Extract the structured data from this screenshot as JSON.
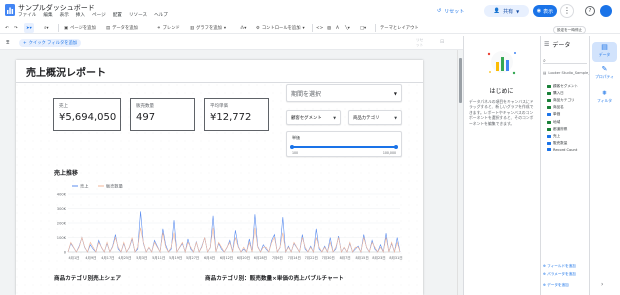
{
  "app": {
    "title": "サンプルダッシュボード",
    "menu": [
      "ファイル",
      "編集",
      "表示",
      "挿入",
      "ページ",
      "配置",
      "リソース",
      "ヘルプ"
    ],
    "reset_label": "リセット",
    "share_label": "共有",
    "view_label": "表示"
  },
  "toolbar": {
    "add_page": "ページを追加",
    "add_data": "データを追加",
    "blend": "ブレンド",
    "add_chart": "グラフを追加",
    "add_control": "コントロールを追加",
    "theme_layout": "テーマとレイアウト",
    "settings": "設定を一時停止"
  },
  "filterbar": {
    "quick_filter": "クイック フィルタを追加",
    "redo_line1": "リセ",
    "redo_line2": "ット"
  },
  "report": {
    "title": "売上概況レポート",
    "scorecards": [
      {
        "label": "売上",
        "value": "¥5,694,050"
      },
      {
        "label": "販売数量",
        "value": "497"
      },
      {
        "label": "平均単価",
        "value": "¥12,772"
      }
    ],
    "date_control": "期間を選択",
    "dropdowns": [
      "顧客セグメント",
      "商品カテゴリ"
    ],
    "slider": {
      "label": "単価",
      "min_label": "100",
      "max_label": "100,000",
      "low": 0.0,
      "high": 1.0
    },
    "line_chart_title": "売上推移",
    "bottom_titles": [
      "商品カテゴリ別売上シェア",
      "商品カテゴリ別：販売数量×単価の売上バブルチャート"
    ]
  },
  "chart_data": {
    "type": "line",
    "legend_position": "top-left",
    "series": [
      {
        "name": "売上",
        "color": "#5b8def",
        "values": [
          0,
          60,
          30,
          0,
          40,
          100,
          30,
          0,
          50,
          20,
          0,
          80,
          30,
          0,
          60,
          0,
          40,
          120,
          20,
          0,
          60,
          0,
          30,
          90,
          0,
          20,
          280,
          60,
          0,
          30,
          0,
          80,
          40,
          0,
          160,
          50,
          0,
          20,
          220,
          0,
          30,
          60,
          0,
          90,
          20,
          0,
          70,
          0,
          40,
          100,
          0,
          30,
          250,
          0,
          60,
          20,
          0,
          30,
          80,
          0,
          150,
          40,
          0,
          20,
          0,
          90,
          0,
          260,
          40,
          0,
          50,
          20,
          0,
          80,
          120,
          0,
          30,
          240,
          0,
          40,
          0,
          60,
          30,
          0,
          120,
          20,
          0,
          40,
          0,
          160,
          20,
          0,
          40,
          0,
          100,
          0,
          20,
          110,
          0,
          30,
          0,
          60,
          0,
          20,
          40,
          0,
          120,
          30,
          0,
          80,
          20,
          0,
          50,
          0,
          130,
          0,
          60,
          0,
          100,
          0
        ]
      },
      {
        "name": "販売数量",
        "color": "#f3b79a",
        "values": [
          0,
          2,
          1,
          0,
          1,
          3,
          1,
          0,
          2,
          1,
          0,
          2,
          1,
          0,
          2,
          0,
          1,
          3,
          1,
          0,
          2,
          0,
          1,
          3,
          0,
          1,
          5,
          2,
          0,
          1,
          0,
          2,
          1,
          0,
          4,
          1,
          0,
          1,
          4,
          0,
          1,
          2,
          0,
          2,
          1,
          0,
          2,
          0,
          1,
          3,
          0,
          1,
          5,
          0,
          2,
          1,
          0,
          1,
          2,
          0,
          3,
          1,
          0,
          1,
          0,
          2,
          0,
          5,
          1,
          0,
          1,
          1,
          0,
          2,
          3,
          0,
          1,
          4,
          0,
          1,
          0,
          2,
          1,
          0,
          3,
          1,
          0,
          1,
          0,
          3,
          1,
          0,
          1,
          0,
          2,
          0,
          1,
          3,
          0,
          1,
          0,
          2,
          0,
          1,
          1,
          0,
          3,
          1,
          0,
          2,
          1,
          0,
          1,
          0,
          3,
          0,
          2,
          0,
          2,
          0
        ]
      }
    ],
    "y_ticks": [
      "0",
      "100K",
      "200K",
      "300K",
      "400K"
    ],
    "y_max": 400,
    "x_ticks": [
      "4月1日",
      "4月9日",
      "4月17日",
      "4月25日",
      "5月3日",
      "5月11日",
      "5月19日",
      "5月27日",
      "6月4日",
      "6月12日",
      "6月20日",
      "6月28日",
      "7月6日",
      "7月14日",
      "7月22日",
      "7月30日",
      "8月7日",
      "8月15日",
      "8月23日",
      "8月31日"
    ],
    "grid": true
  },
  "hint": {
    "heading": "はじめに",
    "body": "データパネルの項目をキャンバスにドラッグすると、新しいグラフを作成できます。レポートやキャンバスのコンポーネントを選択すると、そのコンポーネントを編集できます。"
  },
  "data_panel": {
    "title": "データ",
    "source": "Looker Studio_Sample_...",
    "fields": [
      {
        "name": "顧客セグメント",
        "kind": "dim"
      },
      {
        "name": "購入日",
        "kind": "dim"
      },
      {
        "name": "商品カテゴリ",
        "kind": "dim"
      },
      {
        "name": "商品名",
        "kind": "dim"
      },
      {
        "name": "単価",
        "kind": "num"
      },
      {
        "name": "地域",
        "kind": "dim"
      },
      {
        "name": "都道府県",
        "kind": "dim"
      },
      {
        "name": "売上",
        "kind": "num"
      },
      {
        "name": "販売数量",
        "kind": "num"
      },
      {
        "name": "Record Count",
        "kind": "num"
      }
    ],
    "add_field": "フィールドを追加",
    "add_param": "パラメータを追加",
    "add_data": "データを追加"
  },
  "rail": {
    "data": "データ",
    "properties": "プロパティ",
    "filter": "フィルタ"
  }
}
